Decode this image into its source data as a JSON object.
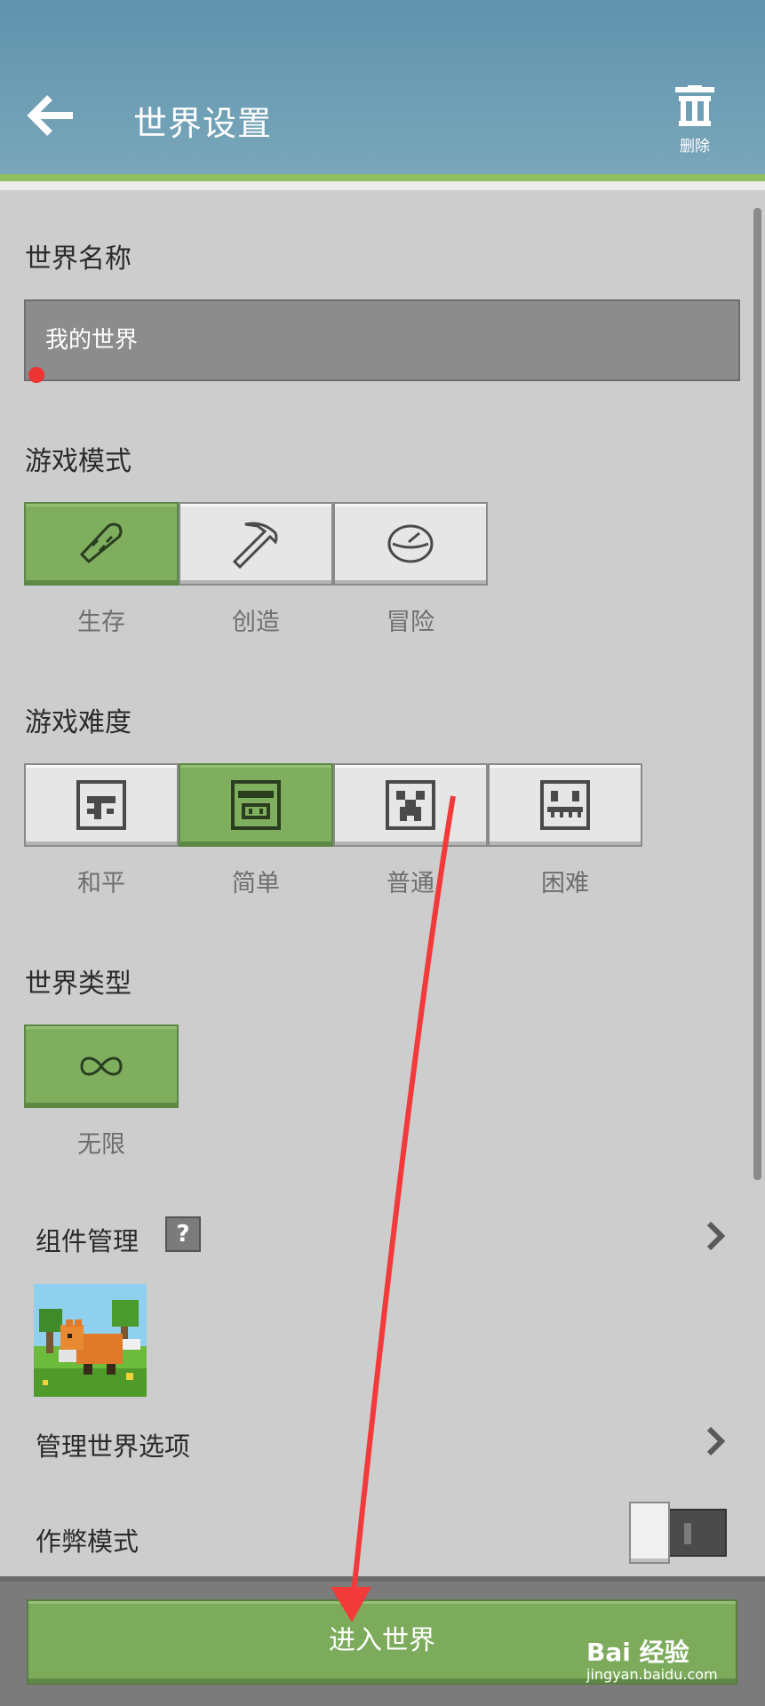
{
  "header": {
    "title": "世界设置",
    "delete_label": "删除"
  },
  "world_name": {
    "label": "世界名称",
    "value": "我的世界"
  },
  "game_mode": {
    "label": "游戏模式",
    "selected": "生存",
    "options": [
      {
        "label": "生存",
        "icon": "bread-icon"
      },
      {
        "label": "创造",
        "icon": "pickaxe-icon"
      },
      {
        "label": "冒险",
        "icon": "compass-icon"
      }
    ]
  },
  "difficulty": {
    "label": "游戏难度",
    "selected": "简单",
    "options": [
      {
        "label": "和平",
        "icon": "peaceful-face-icon"
      },
      {
        "label": "简单",
        "icon": "pig-face-icon"
      },
      {
        "label": "普通",
        "icon": "creeper-face-icon"
      },
      {
        "label": "困难",
        "icon": "ghast-face-icon"
      }
    ]
  },
  "world_type": {
    "label": "世界类型",
    "selected": "无限",
    "options": [
      {
        "label": "无限",
        "icon": "infinity-icon"
      }
    ]
  },
  "addons": {
    "label": "组件管理",
    "help": "?"
  },
  "world_options": {
    "label": "管理世界选项"
  },
  "cheats": {
    "label": "作弊模式",
    "enabled": false
  },
  "footer": {
    "enter_label": "进入世界"
  },
  "watermark": {
    "brand": "Bai 经验",
    "url": "jingyan.baidu.com"
  },
  "colors": {
    "header": "#6a9bb2",
    "accent_green": "#7fae5f",
    "panel": "#cdcdcd",
    "annotation_arrow": "#f23a3a"
  }
}
